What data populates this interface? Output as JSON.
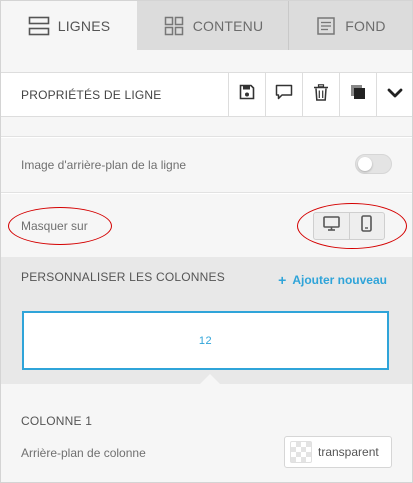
{
  "tabs": [
    {
      "label": "LIGNES",
      "icon": "rows-icon",
      "active": true
    },
    {
      "label": "CONTENU",
      "icon": "grid-icon",
      "active": false
    },
    {
      "label": "FOND",
      "icon": "document-icon",
      "active": false
    }
  ],
  "row_properties": {
    "title": "PROPRIÉTÉS DE LIGNE",
    "actions": [
      "save-icon",
      "comment-icon",
      "trash-icon",
      "duplicate-icon",
      "chevron-down-icon"
    ]
  },
  "settings": {
    "background_image_label": "Image d'arrière-plan de la ligne",
    "background_image_enabled": false,
    "hide_on_label": "Masquer sur",
    "hide_on_devices": [
      "desktop-icon",
      "mobile-icon"
    ]
  },
  "columns": {
    "title": "PERSONNALISER LES COLONNES",
    "add_new_label": "Ajouter nouveau",
    "layout": [
      "12"
    ]
  },
  "column1": {
    "title": "COLONNE 1",
    "background_label": "Arrière-plan de colonne",
    "background_value": "transparent"
  },
  "colors": {
    "accent": "#2fa4d9",
    "annotation": "#d40000"
  }
}
